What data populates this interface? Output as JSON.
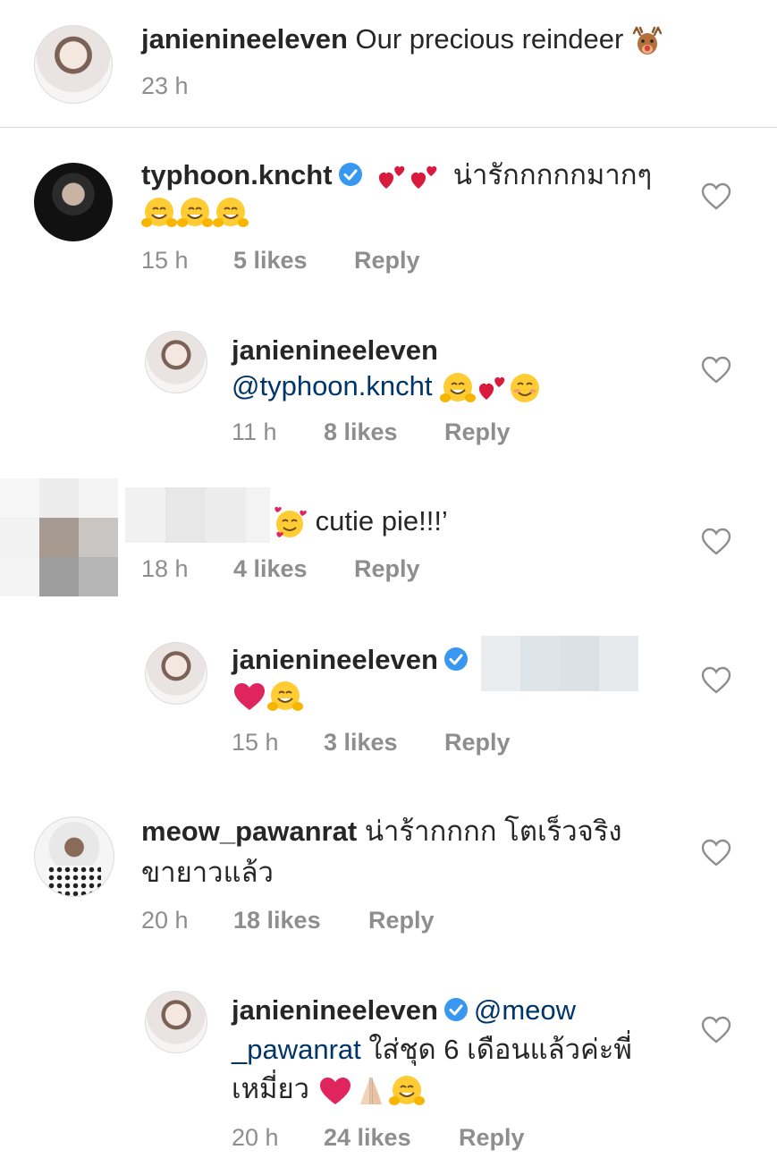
{
  "caption": {
    "username": "janienineeleven",
    "text": "Our precious reindeer",
    "time": "23 h",
    "emoji": "reindeer-emoji"
  },
  "comments": [
    {
      "username": "typhoon.kncht",
      "verified": true,
      "text": "น่ารักกกกกมากๆ",
      "emojis_before": [
        "two-hearts-emoji",
        "two-hearts-emoji"
      ],
      "emojis_after": [
        "hugging-face-emoji",
        "hugging-face-emoji",
        "hugging-face-emoji"
      ],
      "time": "15 h",
      "likes": "5 likes",
      "reply": "Reply"
    },
    {
      "username": "janienineeleven",
      "mention": "@typhoon.kncht",
      "emojis_after": [
        "hugging-face-emoji",
        "two-hearts-emoji",
        "smiling-face-emoji"
      ],
      "time": "11 h",
      "likes": "8 likes",
      "reply": "Reply"
    },
    {
      "username_blurred": true,
      "emojis_before": [
        "smiling-face-with-hearts-emoji"
      ],
      "text": "cutie pie!!!’",
      "time": "18 h",
      "likes": "4 likes",
      "reply": "Reply"
    },
    {
      "username": "janienineeleven",
      "verified": true,
      "mention_blurred": true,
      "emojis_after": [
        "red-heart-emoji",
        "hugging-face-emoji"
      ],
      "time": "15 h",
      "likes": "3 likes",
      "reply": "Reply"
    },
    {
      "username": "meow_pawanrat",
      "text_line1": "น่าร้ากกกก โตเร็วจริง",
      "text_line2": "ขายาวแล้ว",
      "time": "20 h",
      "likes": "18 likes",
      "reply": "Reply"
    },
    {
      "username": "janienineeleven",
      "verified": true,
      "mention_part1": "@meow",
      "mention_part2": "_pawanrat",
      "text_line2": "ใส่ชุด 6 เดือนแล้วค่ะพี่",
      "text_line3": "เหมี่ยว",
      "emojis_after": [
        "red-heart-emoji",
        "folded-hands-emoji",
        "hugging-face-emoji"
      ],
      "time": "20 h",
      "likes": "24 likes",
      "reply": "Reply"
    }
  ],
  "colors": {
    "verified": "#3897f0",
    "heart_red": "#e0245e",
    "meta": "#8e8e8e",
    "mention": "#003569"
  }
}
